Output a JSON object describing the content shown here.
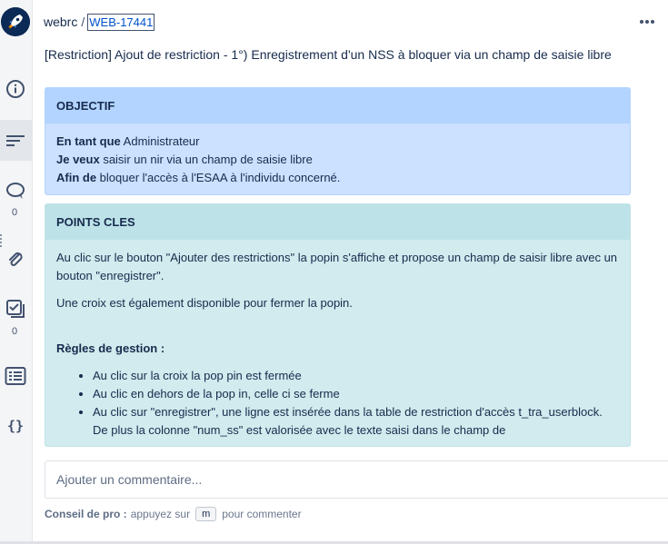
{
  "header": {
    "project": "webrc",
    "separator": "/",
    "issue_key": "WEB-17441",
    "more_icon": "more-horizontal-icon"
  },
  "summary": "[Restriction] Ajout de restriction - 1°) Enregistrement d'un NSS à bloquer via un champ de saisie libre",
  "sidebar": {
    "icons": [
      "rocket-avatar",
      "info-icon",
      "activity-icon",
      "comment-icon",
      "attachment-icon",
      "checklist-icon",
      "subtasks-icon",
      "code-icon"
    ],
    "comment_count": "0",
    "checklist_count": "0"
  },
  "objectif": {
    "title": "OBJECTIF",
    "line1_bold": "En tant que",
    "line1_text": " Administrateur",
    "line2_bold": "Je veux",
    "line2_text": " saisir un nir via un champ de saisie libre",
    "line3_bold": "Afin de",
    "line3_text": " bloquer l'accès à l'ESAA à l'individu concerné."
  },
  "points_cles": {
    "title": "POINTS CLES",
    "para1": "Au clic sur le bouton \"Ajouter des restrictions\" la popin s'affiche et propose un champ de saisir libre avec un bouton \"enregistrer\".",
    "para2": "Une croix est également disponible pour fermer la popin.",
    "rules_title": "Règles de gestion :",
    "rules": [
      "Au clic sur la croix la pop pin est fermée",
      "Au clic en dehors de la pop in, celle ci se ferme",
      "Au clic sur \"enregistrer\", une ligne est insérée dans la table de restriction d'accès t_tra_userblock. De plus la colonne \"num_ss\" est valorisée avec le texte saisi dans le champ de"
    ]
  },
  "comment": {
    "placeholder": "Ajouter un commentaire...",
    "tip_label": "Conseil de pro :",
    "tip_before": "appuyez sur",
    "tip_key": "m",
    "tip_after": "pour commenter"
  },
  "colors": {
    "link": "#0052cc",
    "panel_blue_header": "#b3d4ff",
    "panel_blue_body": "#cce0ff",
    "panel_teal_header": "#bde3e8",
    "panel_teal_body": "#d1ebee"
  }
}
